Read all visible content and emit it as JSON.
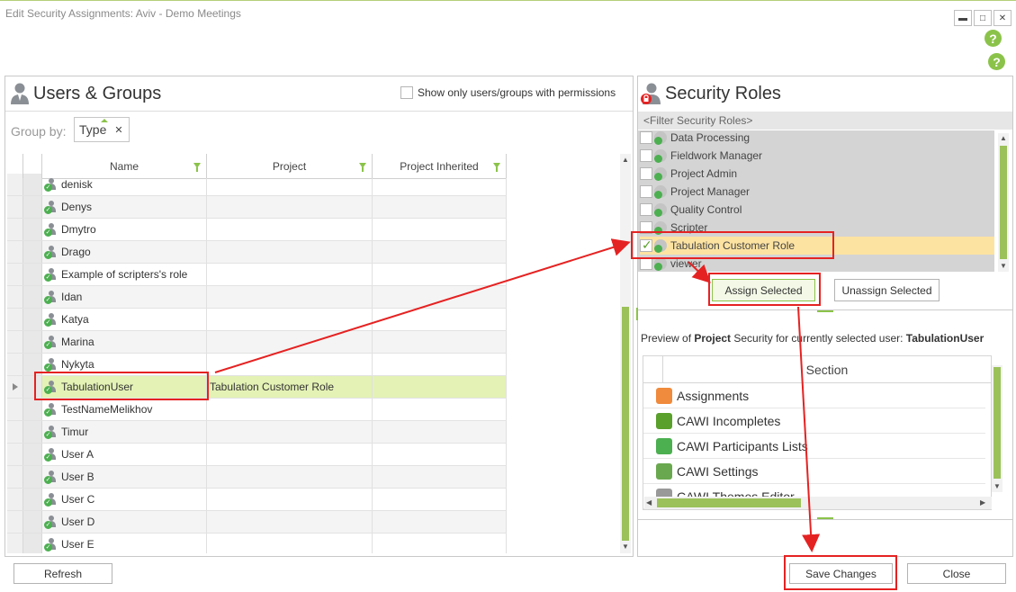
{
  "window": {
    "title": "Edit Security Assignments: Aviv - Demo Meetings",
    "minimize": "▬",
    "maximize": "□",
    "close": "✕",
    "help": "?"
  },
  "users_panel": {
    "title": "Users & Groups",
    "show_only_label": "Show only users/groups with permissions",
    "group_by_label": "Group by:",
    "group_by_chip": "Type",
    "chip_remove": "✕",
    "columns": {
      "name": "Name",
      "project": "Project",
      "project_inherited": "Project Inherited"
    },
    "rows": [
      {
        "name": "denisk",
        "project": ""
      },
      {
        "name": "Denys",
        "project": ""
      },
      {
        "name": "Dmytro",
        "project": ""
      },
      {
        "name": "Drago",
        "project": ""
      },
      {
        "name": "Example of scripters's role",
        "project": ""
      },
      {
        "name": "Idan",
        "project": ""
      },
      {
        "name": "Katya",
        "project": ""
      },
      {
        "name": "Marina",
        "project": ""
      },
      {
        "name": "Nykyta",
        "project": ""
      },
      {
        "name": "TabulationUser",
        "project": "Tabulation Customer Role"
      },
      {
        "name": "TestNameMelikhov",
        "project": ""
      },
      {
        "name": "Timur",
        "project": ""
      },
      {
        "name": "User A",
        "project": ""
      },
      {
        "name": "User B",
        "project": ""
      },
      {
        "name": "User C",
        "project": ""
      },
      {
        "name": "User D",
        "project": ""
      },
      {
        "name": "User E",
        "project": ""
      }
    ],
    "selected_index": 9
  },
  "roles_panel": {
    "title": "Security Roles",
    "filter_placeholder": "<Filter Security Roles>",
    "roles": [
      "Data Processing",
      "Fieldwork Manager",
      "Project Admin",
      "Project Manager",
      "Quality Control",
      "Scripter",
      "Tabulation Customer Role",
      "viewer"
    ],
    "checked_role": "Tabulation Customer Role",
    "assign_label": "Assign Selected",
    "unassign_label": "Unassign Selected"
  },
  "preview": {
    "prefix": "Preview of ",
    "scope": "Project",
    "middle": " Security for currently selected user: ",
    "user": "TabulationUser",
    "section_header": "Section",
    "sections": [
      "Assignments",
      "CAWI Incompletes",
      "CAWI Participants Lists",
      "CAWI Settings",
      "CAWI Themes Editor"
    ]
  },
  "footer": {
    "refresh": "Refresh",
    "save": "Save Changes",
    "close": "Close"
  },
  "colors": {
    "accent": "#8bc34a",
    "annotation": "#e52222",
    "selected_row": "#e4f2b5",
    "selected_role": "#fde3a2"
  }
}
